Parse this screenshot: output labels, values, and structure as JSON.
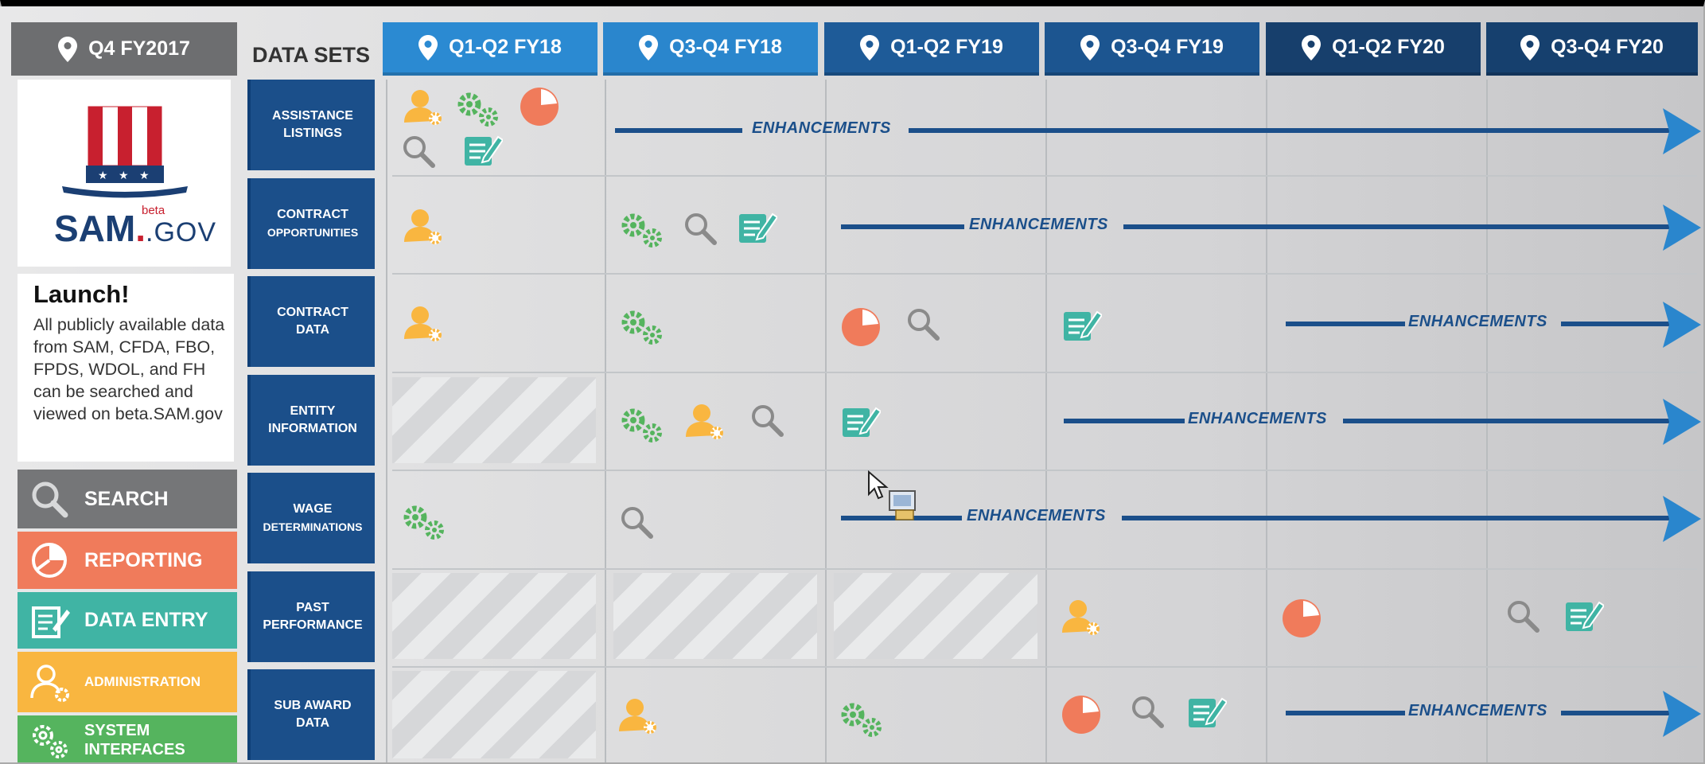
{
  "left_panel": {
    "header_label": "Q4 FY2017",
    "logo": {
      "word": "SAM",
      "sup": "beta",
      "suffix": ".GOV"
    },
    "launch_title": "Launch!",
    "launch_text": "All publicly available data from SAM, CFDA, FBO, FPDS, WDOL, and FH can be searched and viewed on beta.SAM.gov"
  },
  "legend": [
    {
      "label": "SEARCH",
      "icon": "magnifier-icon",
      "color": "#757678"
    },
    {
      "label": "REPORTING",
      "icon": "pie-chart-icon",
      "color": "#f07b5b"
    },
    {
      "label": "DATA ENTRY",
      "icon": "pencil-form-icon",
      "color": "#40b4a4"
    },
    {
      "label": "ADMINISTRATION",
      "icon": "user-gear-icon",
      "color": "#f9b640"
    },
    {
      "label": "SYSTEM\nINTERFACES",
      "icon": "gears-icon",
      "color": "#55b45e"
    }
  ],
  "data_sets_title": "DATA SETS",
  "data_sets": [
    {
      "line1": "ASSISTANCE",
      "line2": "LISTINGS"
    },
    {
      "line1": "CONTRACT",
      "line2": "OPPORTUNITIES"
    },
    {
      "line1": "CONTRACT",
      "line2": "DATA"
    },
    {
      "line1": "ENTITY",
      "line2": "INFORMATION"
    },
    {
      "line1": "WAGE",
      "line2": "DETERMINATIONS"
    },
    {
      "line1": "PAST",
      "line2": "PERFORMANCE"
    },
    {
      "line1": "SUB AWARD",
      "line2": "DATA"
    }
  ],
  "columns": [
    {
      "label": "Q1-Q2 FY18",
      "color": "#2b8ad2"
    },
    {
      "label": "Q3-Q4 FY18",
      "color": "#2a86cd"
    },
    {
      "label": "Q1-Q2 FY19",
      "color": "#1e5b98"
    },
    {
      "label": "Q3-Q4 FY19",
      "color": "#1c5590"
    },
    {
      "label": "Q1-Q2 FY20",
      "color": "#173f6c"
    },
    {
      "label": "Q3-Q4 FY20",
      "color": "#16406e"
    }
  ],
  "enhancement_label": "ENHANCEMENTS",
  "colors": {
    "admin": "#f9b640",
    "system": "#55b45e",
    "reporting": "#f07b5b",
    "search": "#8a8a8a",
    "entry": "#40b4a4",
    "navy": "#1b4f8a",
    "arrow_light": "#2a86cd"
  }
}
